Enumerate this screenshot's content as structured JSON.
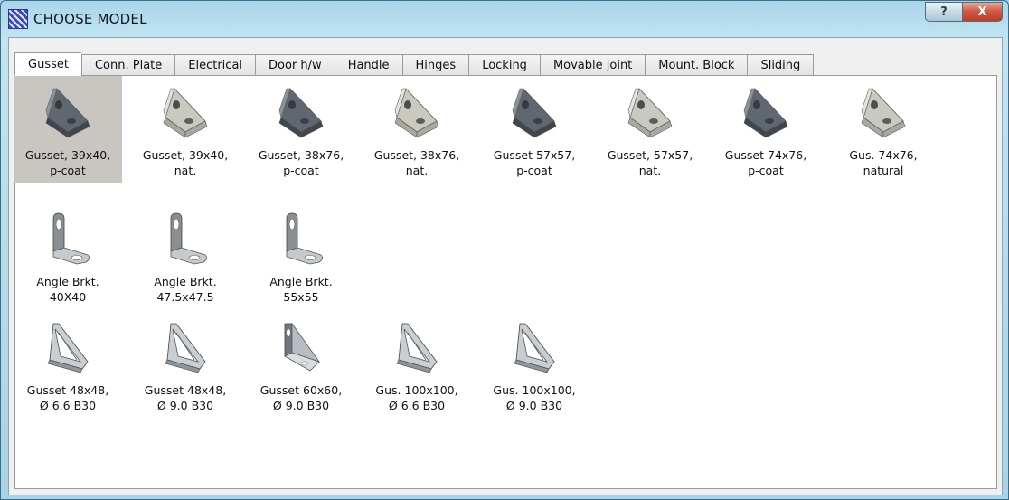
{
  "window": {
    "title": "CHOOSE MODEL",
    "help_label": "?",
    "close_label": "X"
  },
  "tabs": [
    {
      "label": "Gusset",
      "active": true
    },
    {
      "label": "Conn. Plate"
    },
    {
      "label": "Electrical"
    },
    {
      "label": "Door h/w"
    },
    {
      "label": "Handle"
    },
    {
      "label": "Hinges"
    },
    {
      "label": "Locking"
    },
    {
      "label": "Movable joint"
    },
    {
      "label": "Mount. Block"
    },
    {
      "label": "Sliding"
    }
  ],
  "items": [
    {
      "label": "Gusset, 39x40,\np-coat",
      "icon": "gusset-pcoat-icon",
      "selected": true
    },
    {
      "label": "Gusset, 39x40,\nnat.",
      "icon": "gusset-natural-icon"
    },
    {
      "label": "Gusset, 38x76,\np-coat",
      "icon": "gusset-pcoat-icon"
    },
    {
      "label": "Gusset, 38x76,\nnat.",
      "icon": "gusset-natural-icon"
    },
    {
      "label": "Gusset 57x57,\np-coat",
      "icon": "gusset-pcoat-icon"
    },
    {
      "label": "Gusset, 57x57,\nnat.",
      "icon": "gusset-natural-icon"
    },
    {
      "label": "Gusset 74x76,\np-coat",
      "icon": "gusset-pcoat-icon"
    },
    {
      "label": "Gus. 74x76,\nnatural",
      "icon": "gusset-natural-icon"
    },
    {
      "label": "Angle Brkt.\n40X40",
      "icon": "angle-bracket-icon"
    },
    {
      "label": "Angle Brkt.\n47.5x47.5",
      "icon": "angle-bracket-icon"
    },
    {
      "label": "Angle Brkt.\n55x55",
      "icon": "angle-bracket-icon"
    },
    {
      "label": "Gusset 48x48,\nØ 6.6 B30",
      "icon": "ribbed-gusset-icon"
    },
    {
      "label": "Gusset 48x48,\nØ 9.0 B30",
      "icon": "ribbed-gusset-icon"
    },
    {
      "label": "Gusset 60x60,\nØ 9.0 B30",
      "icon": "plate-gusset-icon"
    },
    {
      "label": "Gus. 100x100,\nØ 6.6 B30",
      "icon": "ribbed-gusset-icon"
    },
    {
      "label": "Gus. 100x100,\nØ 9.0 B30",
      "icon": "ribbed-gusset-icon"
    }
  ]
}
